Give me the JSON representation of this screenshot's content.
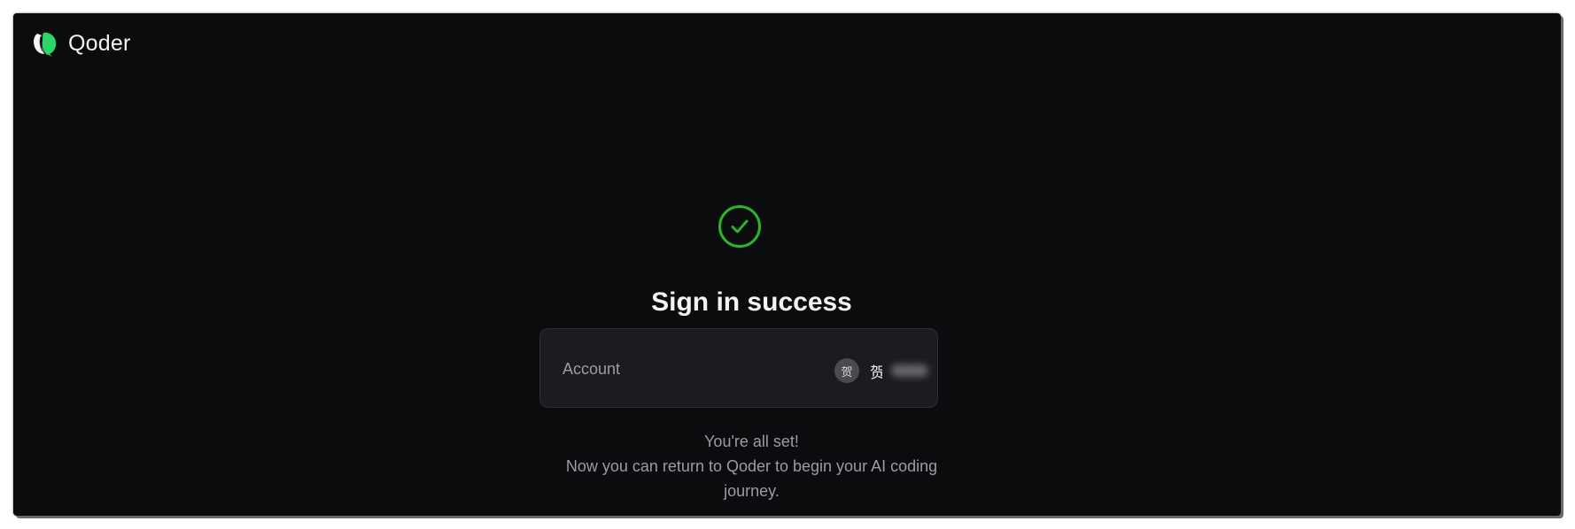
{
  "brand": {
    "name": "Qoder",
    "logo_icon": "qoder-logo-icon",
    "logo_color": "#2dd66b"
  },
  "status": {
    "icon": "check-circle-icon",
    "color": "#2bb52b",
    "title": "Sign in success"
  },
  "account": {
    "label": "Account",
    "avatar_initial": "贺",
    "name_visible": "贺",
    "name_obscured": true
  },
  "message": {
    "line1": "You're all set!",
    "line2": "Now you can return to Qoder to begin your AI coding journey."
  },
  "colors": {
    "background": "#0b0c0e",
    "card": "#1b1c1f",
    "muted_text": "#9b9da3",
    "primary_text": "#f3f3f3"
  }
}
